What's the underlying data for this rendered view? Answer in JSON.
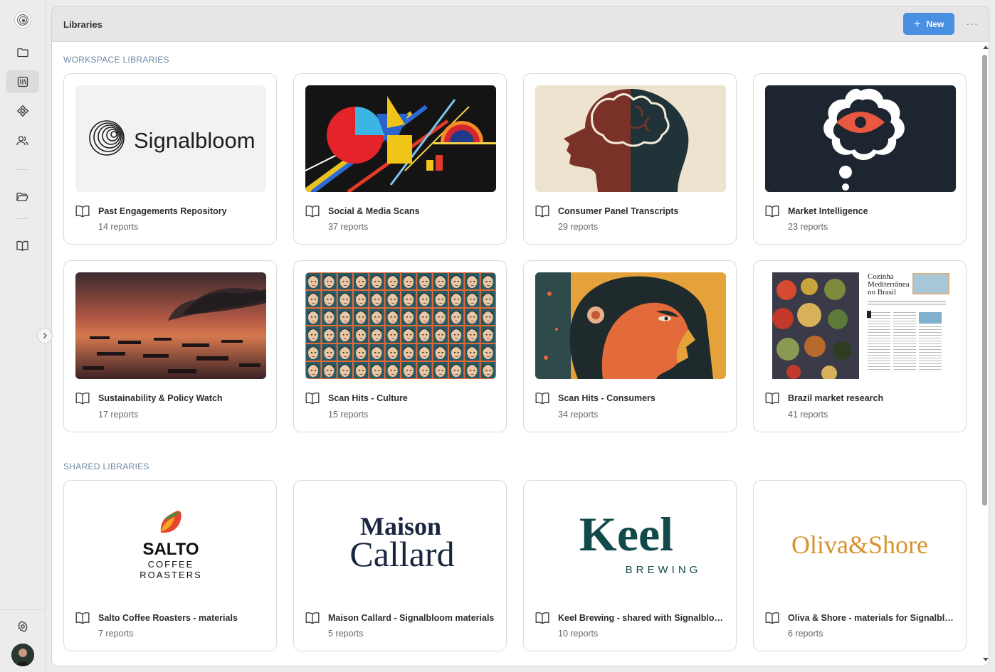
{
  "header": {
    "title": "Libraries",
    "new_label": "New",
    "more_label": "···"
  },
  "sections": {
    "workspace": "WORKSPACE LIBRARIES",
    "shared": "SHARED LIBRARIES"
  },
  "workspace_libraries": [
    {
      "name": "Past Engagements Repository",
      "count": "14 reports",
      "thumb_text": "Signalbloom"
    },
    {
      "name": "Social & Media Scans",
      "count": "37 reports"
    },
    {
      "name": "Consumer Panel Transcripts",
      "count": "29 reports"
    },
    {
      "name": "Market Intelligence",
      "count": "23 reports"
    },
    {
      "name": "Sustainability & Policy Watch",
      "count": "17 reports"
    },
    {
      "name": "Scan Hits - Culture",
      "count": "15 reports"
    },
    {
      "name": "Scan Hits - Consumers",
      "count": "34 reports"
    },
    {
      "name": "Brazil market research",
      "count": "41 reports",
      "thumb_text": [
        "Cozinha",
        "Mediterrânea",
        "no Brasil"
      ]
    }
  ],
  "shared_libraries": [
    {
      "name": "Salto Coffee Roasters - materials",
      "count": "7 reports",
      "logo_text": [
        "SALTO",
        "COFFEE",
        "ROASTERS"
      ]
    },
    {
      "name": "Maison Callard - Signalbloom materials",
      "count": "5 reports",
      "logo_text": [
        "Maison",
        "Callard"
      ]
    },
    {
      "name": "Keel Brewing - shared with Signalbloom",
      "count": "10 reports",
      "logo_text": [
        "Keel",
        "BREWING"
      ]
    },
    {
      "name": "Oliva & Shore - materials for Signalbloom",
      "count": "6 reports",
      "logo_text": "Oliva&Shore"
    }
  ],
  "colors": {
    "accent": "#4a90e2",
    "section_title": "#6f88a2"
  },
  "icons": {
    "rail": [
      "logo-icon",
      "folder-icon",
      "library-icon",
      "integrations-icon",
      "users-icon",
      "folder-open-icon",
      "book-icon",
      "settings-icon"
    ],
    "card": "book-icon"
  }
}
